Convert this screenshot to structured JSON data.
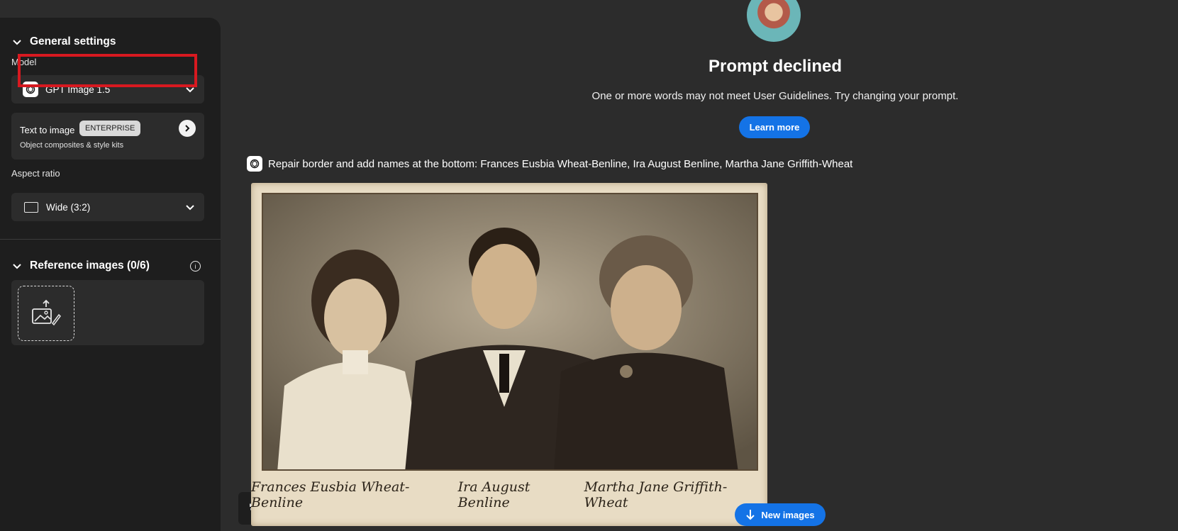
{
  "sidebar": {
    "general_settings": "General settings",
    "model_label": "Model",
    "model_value": "GPT Image 1.5",
    "card": {
      "title": "Text to image",
      "badge": "ENTERPRISE",
      "subtitle": "Object composites & style kits"
    },
    "aspect_label": "Aspect ratio",
    "aspect_value": "Wide (3:2)",
    "reference_images": "Reference images (0/6)"
  },
  "main": {
    "declined_title": "Prompt declined",
    "declined_message": "One or more words may not meet User Guidelines. Try changing your prompt.",
    "learn_more": "Learn more",
    "prompt_text": "Repair border and add names at the bottom: Frances Eusbia Wheat-Benline, Ira August Benline, Martha Jane Griffith-Wheat",
    "photo_names": [
      "Frances Eusbia Wheat-Benline",
      "Ira August Benline",
      "Martha Jane Griffith-Wheat"
    ],
    "new_images": "New images"
  },
  "colors": {
    "accent": "#1473e6",
    "highlight": "#d71920",
    "sidebar_bg": "#1e1e1e",
    "main_bg": "#2c2c2c"
  },
  "icons": [
    "chevron-down-icon",
    "openai-icon",
    "arrow-right-icon",
    "aspect-rect-icon",
    "info-icon",
    "upload-image-icon",
    "history-icon",
    "arrow-down-icon"
  ]
}
